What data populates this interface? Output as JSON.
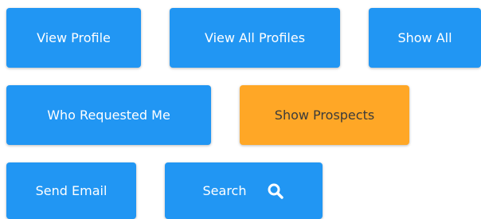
{
  "buttons": {
    "view_profile": "View Profile",
    "view_all_profiles": "View All Profiles",
    "show_all": "Show All",
    "who_requested_me": "Who Requested Me",
    "show_prospects": "Show Prospects",
    "send_email": "Send Email",
    "search": "Search"
  },
  "icons": {
    "search": "search-icon"
  },
  "colors": {
    "primary_button": "#2196f3",
    "highlight_button": "#ffa726",
    "primary_text": "#ffffff",
    "highlight_text": "#3b3b3b"
  }
}
